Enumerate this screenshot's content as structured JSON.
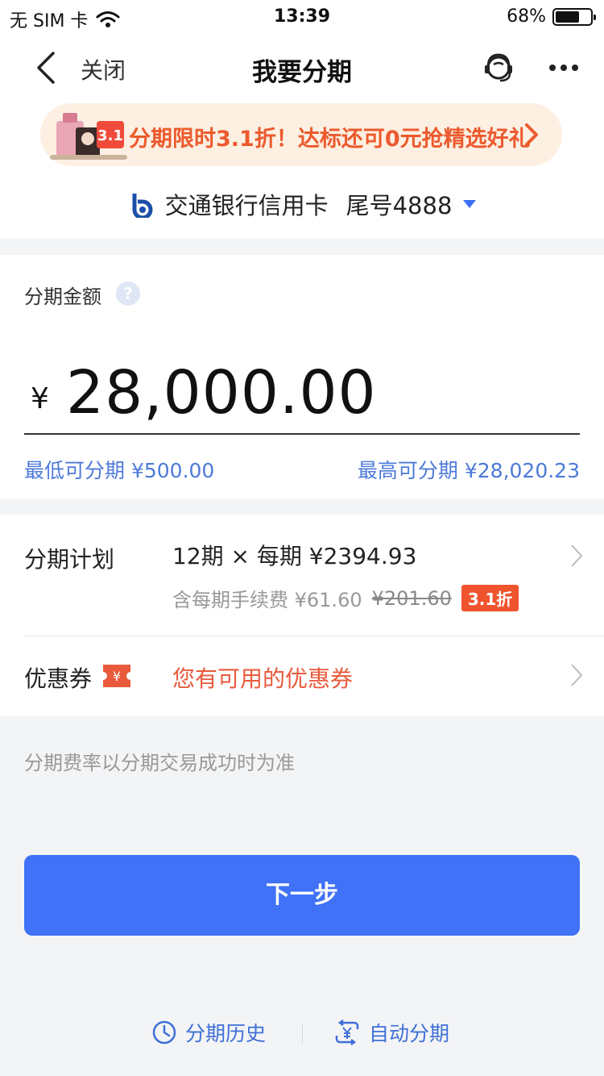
{
  "status_bar": {
    "carrier": "无 SIM 卡",
    "time": "13:39",
    "battery_percent": "68%",
    "battery_level": 0.68
  },
  "nav": {
    "close_label": "关闭",
    "title": "我要分期"
  },
  "promo": {
    "text": "分期限时3.1折！达标还可0元抢精选好礼",
    "badge": "3.1"
  },
  "card": {
    "bank_name": "交通银行信用卡",
    "tail": "尾号4888"
  },
  "amount": {
    "label": "分期金额",
    "help": "?",
    "currency": "¥",
    "value": "28,000.00",
    "min_label": "最低可分期 ¥500.00",
    "max_label": "最高可分期 ¥28,020.23"
  },
  "plan": {
    "title": "分期计划",
    "main": "12期 × 每期 ¥2394.93",
    "fee_prefix": "含每期手续费 ¥61.60",
    "fee_original": "¥201.60",
    "discount_badge": "3.1折"
  },
  "coupon": {
    "title": "优惠券",
    "icon_symbol": "¥",
    "text": "您有可用的优惠券"
  },
  "note": "分期费率以分期交易成功时为准",
  "next_button": "下一步",
  "bottom_links": {
    "history": "分期历史",
    "auto": "自动分期"
  },
  "colors": {
    "accent_blue": "#3f72f6",
    "link_blue": "#4d7ad9",
    "promo_orange": "#ec5a2d",
    "coupon_red": "#e85a3b"
  }
}
